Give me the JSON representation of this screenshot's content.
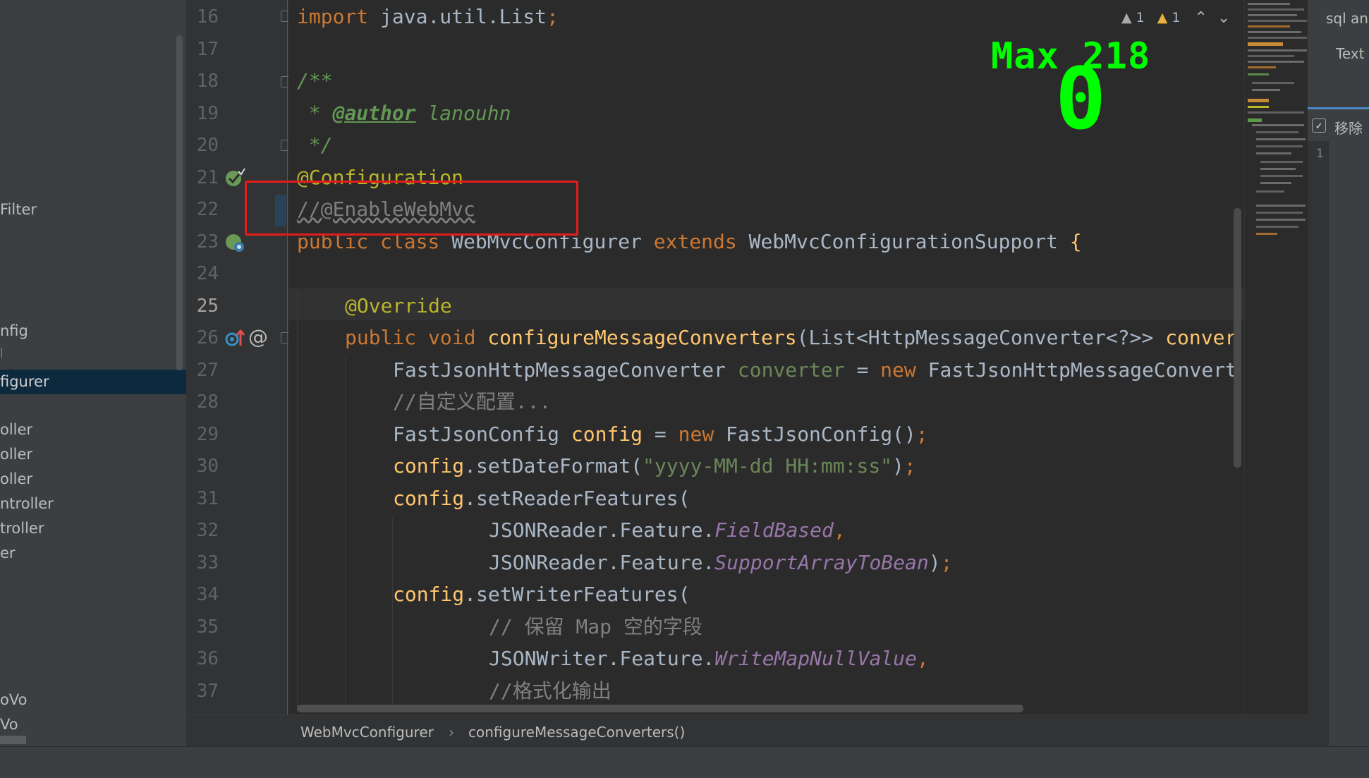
{
  "sidebar": {
    "items": [
      "Filter",
      "nfig",
      "figurer",
      "oller",
      "oller",
      "oller",
      "ntroller",
      "troller",
      "er",
      "oVo",
      "Vo"
    ],
    "selected_index": 2
  },
  "editor": {
    "line_numbers": [
      16,
      17,
      18,
      19,
      20,
      21,
      22,
      23,
      24,
      25,
      26,
      27,
      28,
      29,
      30,
      31,
      32,
      33,
      34,
      35,
      36,
      37
    ],
    "current_line": 25,
    "code": {
      "l16_kw": "import",
      "l16_rest": " java.util.List",
      "l16_semi": ";",
      "l18": "/**",
      "l19_star": " * ",
      "l19_tag": "@author",
      "l19_name": " lanouhn",
      "l20": " */",
      "l21": "@Configuration",
      "l22": "//@EnableWebMvc",
      "l23_kw1": "public class ",
      "l23_cls": "WebMvcConfigurer ",
      "l23_kw2": "extends ",
      "l23_sup": "WebMvcConfigurationSupport ",
      "l23_brace": "{",
      "l25": "@Override",
      "l26_kw": "public void ",
      "l26_fn": "configureMessageConverters",
      "l26_p1": "(List<HttpMessageConverter<?>> ",
      "l26_param": "conver",
      "l27_type": "FastJsonHttpMessageConverter ",
      "l27_var": "converter",
      "l27_eq": " = ",
      "l27_new": "new ",
      "l27_rest": "FastJsonHttpMessageConvert",
      "l28": "//自定义配置...",
      "l29_type": "FastJsonConfig ",
      "l29_var": "config",
      "l29_eq": " = ",
      "l29_new": "new ",
      "l29_rest": "FastJsonConfig()",
      "l29_semi": ";",
      "l30_obj": "config",
      "l30_m": ".setDateFormat(",
      "l30_str": "\"yyyy-MM-dd HH:mm:ss\"",
      "l30_end": ")",
      "l30_semi": ";",
      "l31_obj": "config",
      "l31_m": ".setReaderFeatures(",
      "l32_pre": "JSONReader.Feature.",
      "l32_fld": "FieldBased",
      "l32_c": ",",
      "l33_pre": "JSONReader.Feature.",
      "l33_fld": "SupportArrayToBean",
      "l33_end": ")",
      "l33_semi": ";",
      "l34_obj": "config",
      "l34_m": ".setWriterFeatures(",
      "l35": "// 保留 Map 空的字段",
      "l36_pre": "JSONWriter.Feature.",
      "l36_fld": "WriteMapNullValue",
      "l36_c": ",",
      "l37": "//格式化输出"
    }
  },
  "inspections": {
    "weak_warnings": "1",
    "warnings": "1"
  },
  "overlay": {
    "max_label": "Max  218",
    "value": "0"
  },
  "right_panel": {
    "tab1": "sql an",
    "tab2": "Text",
    "checkbox_label": "移除",
    "count": "1"
  },
  "breadcrumbs": [
    "WebMvcConfigurer",
    "configureMessageConverters()"
  ],
  "colors": {
    "accent_green": "#00ff00",
    "highlight_red": "#e51c1c",
    "selection": "#0d293e"
  },
  "icons": [
    "spring-bean-icon",
    "override-up-icon",
    "at-sign-icon",
    "warning-icon",
    "chevron-up-icon",
    "chevron-down-icon",
    "checkbox-icon"
  ]
}
